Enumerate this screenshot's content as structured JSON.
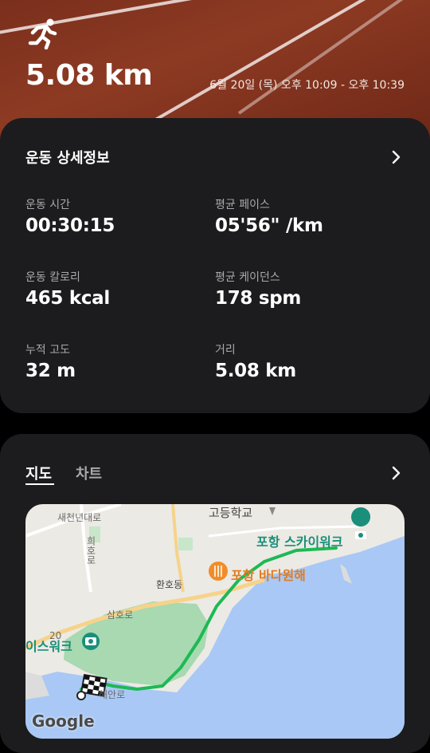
{
  "hero": {
    "icon": "running-person-icon",
    "distance": "5.08 km",
    "datetime": "6월 20일 (목) 오후 10:09 - 오후 10:39"
  },
  "details": {
    "title": "운동 상세정보",
    "stats": [
      {
        "label": "운동 시간",
        "value": "00:30:15"
      },
      {
        "label": "평균 페이스",
        "value": "05'56\" /km"
      },
      {
        "label": "운동 칼로리",
        "value": "465 kcal"
      },
      {
        "label": "평균 케이던스",
        "value": "178 spm"
      },
      {
        "label": "누적 고도",
        "value": "32 m"
      },
      {
        "label": "거리",
        "value": "5.08 km"
      }
    ]
  },
  "map_card": {
    "tabs": [
      {
        "label": "지도",
        "active": true
      },
      {
        "label": "차트",
        "active": false
      }
    ],
    "map": {
      "labels": {
        "road1": "새천년대로",
        "road2": "희호로",
        "road3": "삼호로",
        "road_num": "20",
        "district": "환호동",
        "school": "고등학교",
        "poi_sky": "포항 스카이워크",
        "poi_food": "포항 바다원해",
        "poi_left": "이스워크",
        "finish_road": "해안로"
      },
      "provider": "Google"
    }
  },
  "colors": {
    "route": "#1db954",
    "sea": "#a9c8f5",
    "land": "#eceae4",
    "park": "#a8d9b1",
    "poi": "#1a8f7a",
    "food": "#e07c1f"
  }
}
